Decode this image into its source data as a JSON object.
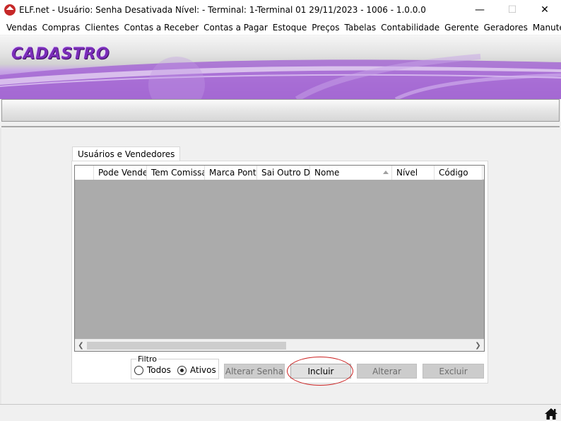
{
  "window": {
    "title": "ELF.net -   Usuário: Senha Desativada   Nível: -    Terminal: 1-Terminal 01    29/11/2023 - 1006 - 1.0.0.0",
    "controls": [
      "minimize-icon",
      "maximize-icon",
      "close-icon"
    ]
  },
  "menu": {
    "items": [
      "Vendas",
      "Compras",
      "Clientes",
      "Contas a Receber",
      "Contas a Pagar",
      "Estoque",
      "Preços",
      "Tabelas",
      "Contabilidade",
      "Gerente",
      "Geradores",
      "Manutenção"
    ]
  },
  "banner": {
    "title": "CADASTRO"
  },
  "tabs": [
    "Usuários e Vendedores"
  ],
  "grid": {
    "columns": [
      "",
      "Pode Vender",
      "Tem Comissao",
      "Marca Ponto",
      "Sai Outro Dia",
      "Nome",
      "Nível",
      "Código"
    ],
    "sorted_column": "Nome",
    "rows": []
  },
  "filter": {
    "label": "Filtro",
    "options": [
      "Todos",
      "Ativos"
    ],
    "selected": "Ativos"
  },
  "buttons": {
    "alterar_senha": "Alterar Senha",
    "incluir": "Incluir",
    "alterar": "Alterar",
    "excluir": "Excluir"
  },
  "colors": {
    "banner_accent": "#9a62cc",
    "banner_title": "#7a2db8",
    "grid_background": "#ababab",
    "highlight_ring": "#cc2222"
  }
}
